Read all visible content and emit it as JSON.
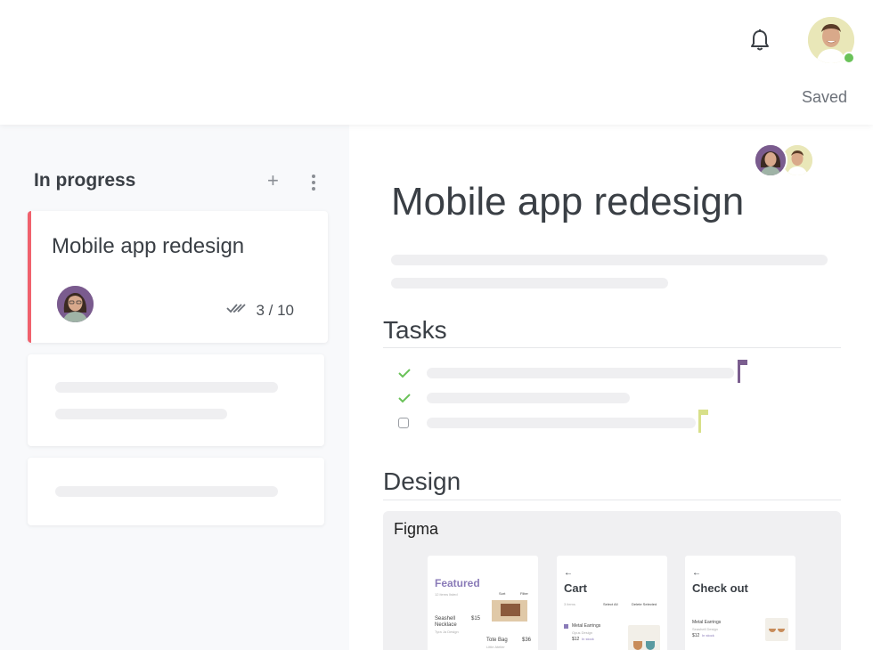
{
  "header": {
    "saved_label": "Saved",
    "notification_icon": "bell-icon",
    "avatar_online_color": "#6ac259"
  },
  "board": {
    "column_title": "In progress",
    "add_label": "+",
    "cards": [
      {
        "title": "Mobile app redesign",
        "progress": "3 / 10",
        "accent": "#f0616d"
      }
    ]
  },
  "detail": {
    "title": "Mobile app redesign",
    "sections": {
      "tasks": "Tasks",
      "design": "Design"
    },
    "tasks": [
      {
        "done": true,
        "flag_color": "#7b5e8f"
      },
      {
        "done": true,
        "flag_color": ""
      },
      {
        "done": false,
        "flag_color": "#d8e08a"
      }
    ],
    "figma": {
      "label": "Figma",
      "screens": [
        {
          "title": "Featured",
          "subtitle": "12 items listed",
          "sort": "Sort",
          "filter": "Filter",
          "items": [
            {
              "name": "Seashell Necklace",
              "vendor": "Tyra Ja Design",
              "price": "$15"
            },
            {
              "name": "Tote Bag",
              "vendor": "Little Atelier",
              "price": "$36"
            }
          ]
        },
        {
          "title": "Cart",
          "subtitle": "3 items",
          "select_all": "Select All",
          "delete_selected": "Delete Selected",
          "items": [
            {
              "name": "Metal Earrings",
              "vendor": "Opus Design",
              "price": "$12",
              "status": "In stock"
            }
          ]
        },
        {
          "title": "Check out",
          "items": [
            {
              "name": "Metal Earrings",
              "vendor": "Seashell Design",
              "price": "$12",
              "status": "In stock"
            }
          ]
        }
      ]
    }
  }
}
